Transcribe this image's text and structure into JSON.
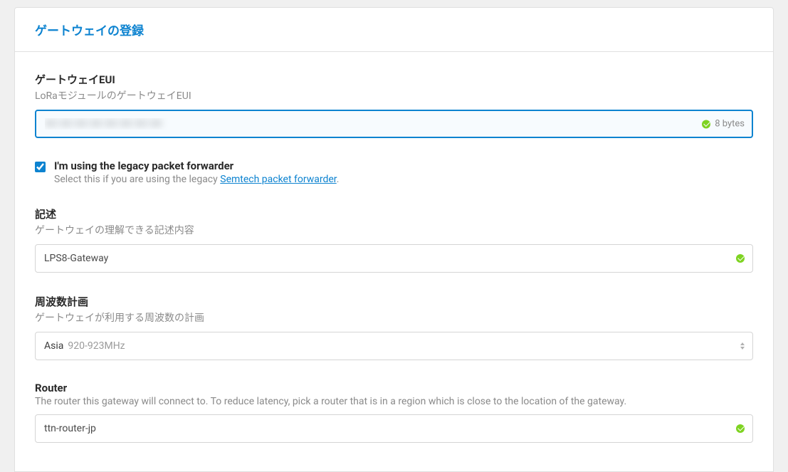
{
  "header": {
    "title": "ゲートウェイの登録"
  },
  "eui": {
    "label": "ゲートウェイEUI",
    "subtext": "LoRaモジュールのゲートウェイEUI",
    "value": "XX XX XX XX XX XX XX XX",
    "bytes": "8 bytes"
  },
  "legacy": {
    "checked": true,
    "label": "I'm using the legacy packet forwarder",
    "subtext_prefix": "Select this if you are using the legacy ",
    "link_text": "Semtech packet forwarder",
    "subtext_suffix": "."
  },
  "description": {
    "label": "記述",
    "subtext": "ゲートウェイの理解できる記述内容",
    "value": "LPS8-Gateway"
  },
  "frequency": {
    "label": "周波数計画",
    "subtext": "ゲートウェイが利用する周波数の計画",
    "selected_region": "Asia",
    "selected_freq": "920-923MHz"
  },
  "router": {
    "label": "Router",
    "subtext": "The router this gateway will connect to. To reduce latency, pick a router that is in a region which is close to the location of the gateway.",
    "value": "ttn-router-jp"
  }
}
